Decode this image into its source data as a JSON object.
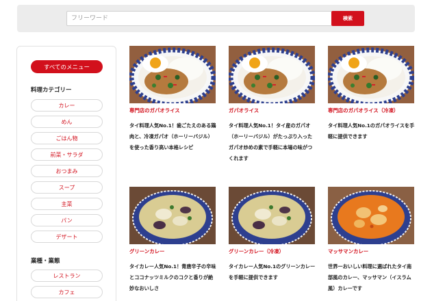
{
  "search": {
    "placeholder": "フリーワード",
    "button_label": "検索",
    "accent": "#d2101c"
  },
  "sidebar": {
    "all_menu_label": "すべてのメニュー",
    "category_heading": "料理カテゴリー",
    "categories": [
      "カレー",
      "めん",
      "ごはん物",
      "前菜・サラダ",
      "おつまみ",
      "スープ",
      "主菜",
      "パン",
      "デザート"
    ],
    "industry_heading": "業種・業態",
    "industries": [
      "レストラン",
      "カフェ"
    ]
  },
  "cards": [
    {
      "title": "専門店のガパオライス",
      "desc": "タイ料理人気No.1！歯ごたえのある鶏肉と、冷凍ガパオ（ホーリーバジル）を使った香り高い本格レシピ",
      "image": "gapao-rice-photo"
    },
    {
      "title": "ガパオライス",
      "desc": "タイ料理人気No.1！タイ産のガパオ（ホーリーバジル）がたっぷり入ったガパオ炒めの素で手軽に本場の味がつくれます",
      "image": "gapao-rice-photo"
    },
    {
      "title": "専門店のガパオライス（冷凍）",
      "desc": "タイ料理人気No.1のガパオライスを手軽に提供できます",
      "image": "gapao-rice-photo"
    },
    {
      "title": "グリーンカレー",
      "desc": "タイカレー人気No.1！青唐辛子の辛味とココナッツミルクのコクと香りが絶妙なおいしさ",
      "image": "green-curry-photo"
    },
    {
      "title": "グリーンカレー（冷凍）",
      "desc": "タイカレー人気No.1のグリーンカレーを手軽に提供できます",
      "image": "green-curry-photo"
    },
    {
      "title": "マッサマンカレー",
      "desc": "世界一おいしい料理に選ばれたタイ南部風のカレー、マッサマン（イスラム風）カレーです",
      "image": "massaman-curry-photo"
    }
  ]
}
